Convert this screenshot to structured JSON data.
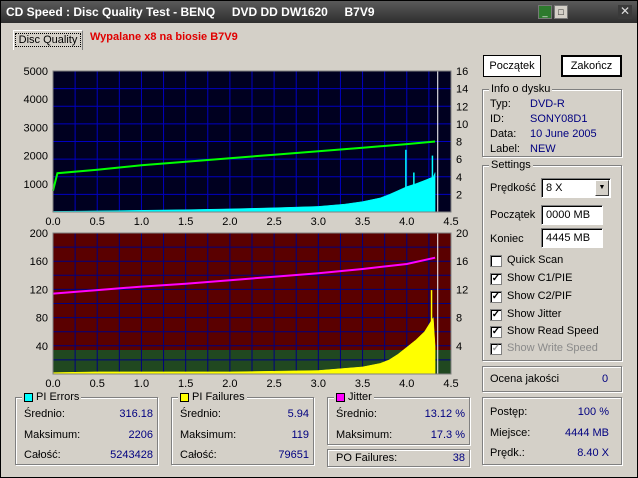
{
  "window": {
    "title": "CD Speed : Disc Quality Test - BENQ     DVD DD DW1620     B7V9",
    "min_icon": "minimize-icon",
    "max_icon": "maximize-icon",
    "close_icon": "close-icon"
  },
  "tabs": {
    "active": "Disc Quality",
    "note": "Wypalane x8 na biosie B7V9"
  },
  "buttons": {
    "start": "Początek",
    "end": "Zakończ"
  },
  "disc_info": {
    "title": "Info o dysku",
    "type_label": "Typ:",
    "type_value": "DVD-R",
    "id_label": "ID:",
    "id_value": "SONY08D1",
    "date_label": "Data:",
    "date_value": "10 June 2005",
    "label_label": "Label:",
    "label_value": "NEW"
  },
  "settings": {
    "title": "Settings",
    "speed_label": "Prędkość",
    "speed_value": "8 X",
    "start_label": "Początek",
    "start_value": "0000 MB",
    "end_label": "Koniec",
    "end_value": "4445 MB",
    "checkboxes": [
      {
        "label": "Quick Scan",
        "checked": false,
        "disabled": false
      },
      {
        "label": "Show C1/PIE",
        "checked": true,
        "disabled": false
      },
      {
        "label": "Show C2/PIF",
        "checked": true,
        "disabled": false
      },
      {
        "label": "Show Jitter",
        "checked": true,
        "disabled": false
      },
      {
        "label": "Show Read Speed",
        "checked": true,
        "disabled": false
      },
      {
        "label": "Show Write Speed",
        "checked": true,
        "disabled": true
      }
    ]
  },
  "quality": {
    "label": "Ocena jakości",
    "value": "0"
  },
  "progress": {
    "progress_label": "Postęp:",
    "progress_value": "100 %",
    "position_label": "Miejsce:",
    "position_value": "4444 MB",
    "speed_label": "Prędk.:",
    "speed_value": "8.40 X"
  },
  "stats": {
    "pi_errors": {
      "title": "PI Errors",
      "color": "#00ffff",
      "avg_label": "Średnio:",
      "avg": "316.18",
      "max_label": "Maksimum:",
      "max": "2206",
      "total_label": "Całość:",
      "total": "5243428"
    },
    "pi_failures": {
      "title": "PI Failures",
      "color": "#ffff00",
      "avg_label": "Średnio:",
      "avg": "5.94",
      "max_label": "Maksimum:",
      "max": "119",
      "total_label": "Całość:",
      "total": "79651"
    },
    "jitter": {
      "title": "Jitter",
      "color": "#ff00ff",
      "avg_label": "Średnio:",
      "avg": "13.12 %",
      "max_label": "Maksimum:",
      "max": "17.3 %"
    },
    "po_failures": {
      "label": "PO Failures:",
      "value": "38"
    }
  },
  "chart_data": [
    {
      "type": "area",
      "name": "pi-errors-chart",
      "x_ticks": [
        "0.0",
        "0.5",
        "1.0",
        "1.5",
        "2.0",
        "2.5",
        "3.0",
        "3.5",
        "4.0",
        "4.5"
      ],
      "y_left_ticks": [
        "1000",
        "2000",
        "3000",
        "4000",
        "5000"
      ],
      "y_right_ticks": [
        "2",
        "4",
        "6",
        "8",
        "10",
        "12",
        "14",
        "16"
      ],
      "xlim": [
        0,
        4.5
      ],
      "ylim_left": [
        0,
        5000
      ],
      "ylim_right": [
        0,
        16
      ],
      "series": [
        {
          "name": "PI Errors",
          "color": "#00ffff",
          "axis": "left",
          "x": [
            0.0,
            0.5,
            1.0,
            1.5,
            2.0,
            2.5,
            3.0,
            3.3,
            3.5,
            3.7,
            3.8,
            3.9,
            4.0,
            4.1,
            4.2,
            4.3,
            4.32
          ],
          "y": [
            20,
            40,
            60,
            80,
            110,
            150,
            200,
            280,
            370,
            500,
            620,
            760,
            900,
            1000,
            1120,
            1250,
            1400
          ]
        },
        {
          "name": "Read Speed",
          "color": "#00ff00",
          "axis": "right",
          "x": [
            0.0,
            0.05,
            0.5,
            1.0,
            1.5,
            2.0,
            2.5,
            3.0,
            3.5,
            4.0,
            4.32
          ],
          "y": [
            2.4,
            4.4,
            4.8,
            5.3,
            5.7,
            6.1,
            6.5,
            6.9,
            7.3,
            7.7,
            8.0
          ]
        }
      ],
      "spikes": [
        {
          "x": 3.99,
          "y": 2206
        },
        {
          "x": 4.08,
          "y": 1400
        },
        {
          "x": 4.26,
          "y": 1200
        },
        {
          "x": 4.29,
          "y": 2000
        }
      ]
    },
    {
      "type": "area",
      "name": "pi-failures-chart",
      "x_ticks": [
        "0.0",
        "0.5",
        "1.0",
        "1.5",
        "2.0",
        "2.5",
        "3.0",
        "3.5",
        "4.0",
        "4.5"
      ],
      "y_left_ticks": [
        "40",
        "80",
        "120",
        "160",
        "200"
      ],
      "y_right_ticks": [
        "4",
        "8",
        "12",
        "16",
        "20"
      ],
      "xlim": [
        0,
        4.5
      ],
      "ylim_left": [
        0,
        200
      ],
      "ylim_right": [
        0,
        20
      ],
      "series": [
        {
          "name": "PI Failures",
          "color": "#ffff00",
          "axis": "left",
          "x": [
            0.0,
            0.5,
            1.0,
            1.5,
            2.0,
            2.5,
            3.0,
            3.5,
            3.7,
            3.8,
            3.9,
            4.0,
            4.1,
            4.2,
            4.3,
            4.32
          ],
          "y": [
            2,
            3,
            3,
            3,
            3,
            4,
            5,
            10,
            15,
            20,
            28,
            38,
            48,
            60,
            80,
            40
          ]
        },
        {
          "name": "Jitter",
          "color": "#ff00ff",
          "axis": "right",
          "x": [
            0.0,
            0.5,
            1.0,
            1.5,
            2.0,
            2.5,
            3.0,
            3.5,
            4.0,
            4.32
          ],
          "y": [
            11.4,
            11.9,
            12.4,
            12.8,
            13.3,
            13.8,
            14.3,
            14.9,
            15.6,
            16.5
          ]
        }
      ],
      "spikes": [
        {
          "x": 4.28,
          "y": 119
        }
      ]
    }
  ]
}
